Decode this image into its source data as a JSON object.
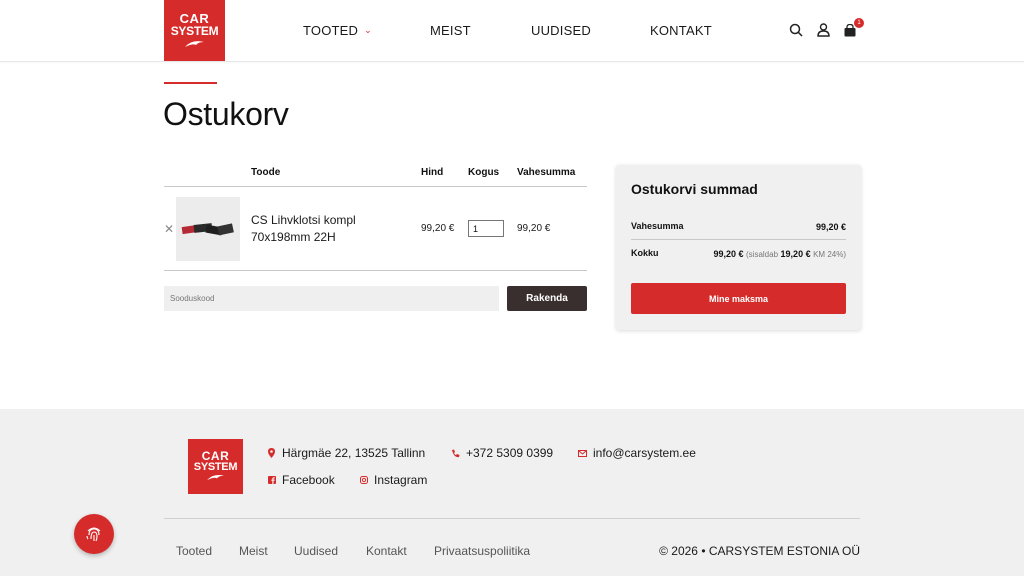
{
  "header": {
    "logo": {
      "line1": "CAR",
      "line2": "SYSTEM"
    },
    "nav": [
      {
        "label": "TOOTED",
        "has_dropdown": true
      },
      {
        "label": "MEIST"
      },
      {
        "label": "UUDISED"
      },
      {
        "label": "KONTAKT"
      }
    ],
    "icons": [
      "search-icon",
      "user-icon",
      "cart-icon"
    ],
    "cart_count": "1",
    "accent_color": "#d62b2b"
  },
  "page": {
    "title": "Ostukorv"
  },
  "cart": {
    "columns": {
      "product": "Toode",
      "price": "Hind",
      "quantity": "Kogus",
      "subtotal": "Vahesumma"
    },
    "items": [
      {
        "name": "CS Lihvklotsi kompl 70x198mm 22H",
        "price": "99,20 €",
        "quantity": "1",
        "subtotal": "99,20 €"
      }
    ],
    "coupon_placeholder": "Sooduskood",
    "apply_label": "Rakenda"
  },
  "totals": {
    "title": "Ostukorvi summad",
    "subtotal_label": "Vahesumma",
    "subtotal_value": "99,20 €",
    "total_label": "Kokku",
    "total_value": "99,20 €",
    "tax_prefix": "(sisaldab",
    "tax_value": "19,20 €",
    "tax_suffix": "KM 24%)",
    "checkout_label": "Mine maksma"
  },
  "footer": {
    "logo": {
      "line1": "CAR",
      "line2": "SYSTEM"
    },
    "address": "Härgmäe 22, 13525 Tallinn",
    "phone": "+372 5309 0399",
    "email": "info@carsystem.ee",
    "facebook": "Facebook",
    "instagram": "Instagram",
    "links": [
      "Tooted",
      "Meist",
      "Uudised",
      "Kontakt",
      "Privaatsuspoliitika"
    ],
    "copyright": "© 2026 • CARSYSTEM ESTONIA OÜ"
  }
}
